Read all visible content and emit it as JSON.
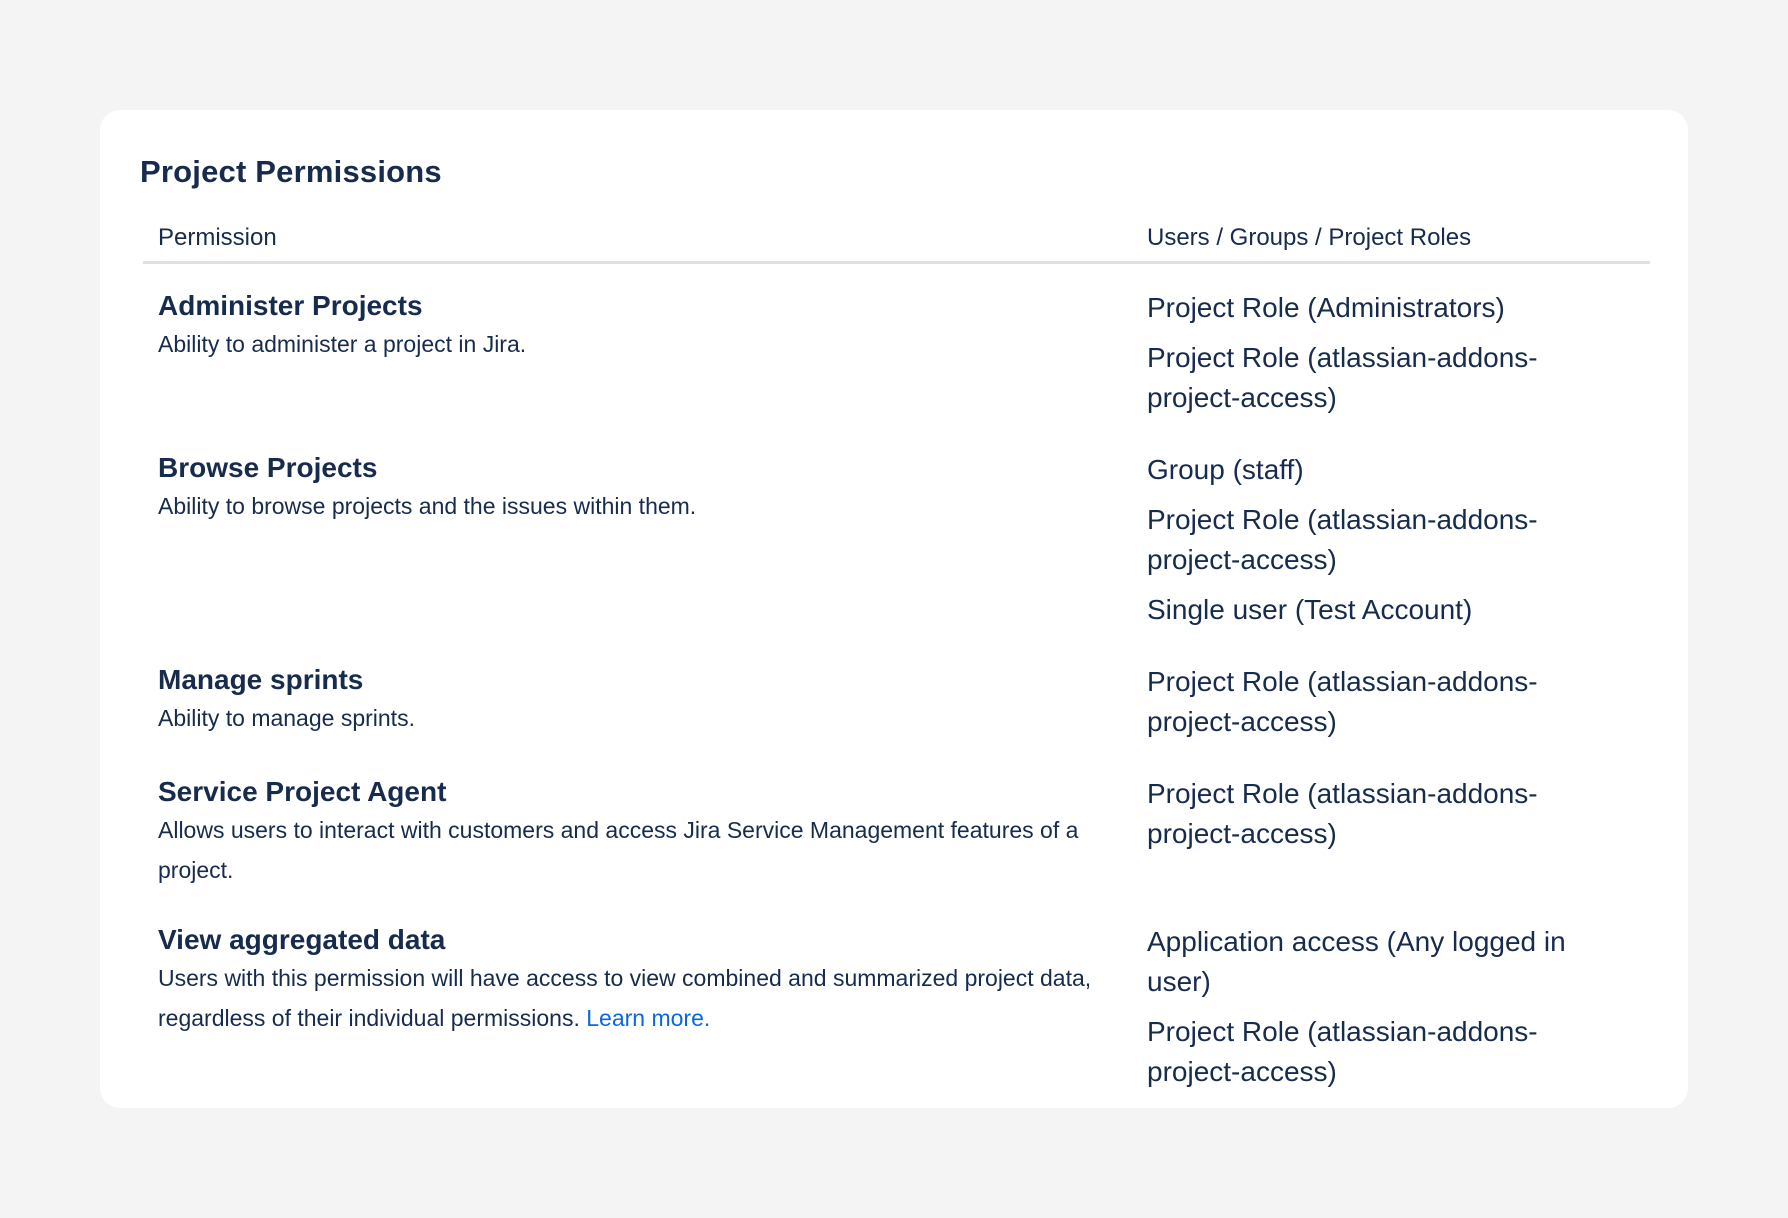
{
  "page": {
    "title": "Project Permissions"
  },
  "table": {
    "headers": {
      "permission": "Permission",
      "grants": "Users / Groups / Project Roles"
    },
    "rows": [
      {
        "name": "Administer Projects",
        "description": "Ability to administer a project in Jira.",
        "grants": [
          "Project Role (Administrators)",
          "Project Role (atlassian-addons-project-access)"
        ]
      },
      {
        "name": "Browse Projects",
        "description": "Ability to browse projects and the issues within them.",
        "grants": [
          "Group (staff)",
          "Project Role (atlassian-addons-project-access)",
          "Single user (Test Account)"
        ]
      },
      {
        "name": "Manage sprints",
        "description": "Ability to manage sprints.",
        "grants": [
          "Project Role (atlassian-addons-project-access)"
        ]
      },
      {
        "name": "Service Project Agent",
        "description": "Allows users to interact with customers and access Jira Service Management features of a project.",
        "grants": [
          "Project Role (atlassian-addons-project-access)"
        ]
      },
      {
        "name": "View aggregated data",
        "description": "Users with this permission will have access to view combined and summarized project data, regardless of their individual permissions.",
        "link_text": "Learn more.",
        "grants": [
          "Application access (Any logged in user)",
          "Project Role (atlassian-addons-project-access)"
        ]
      }
    ]
  },
  "colors": {
    "text": "#172b4d",
    "link": "#0c66e4",
    "divider": "#dfe1e6",
    "background": "#f4f4f4",
    "card": "#ffffff"
  }
}
